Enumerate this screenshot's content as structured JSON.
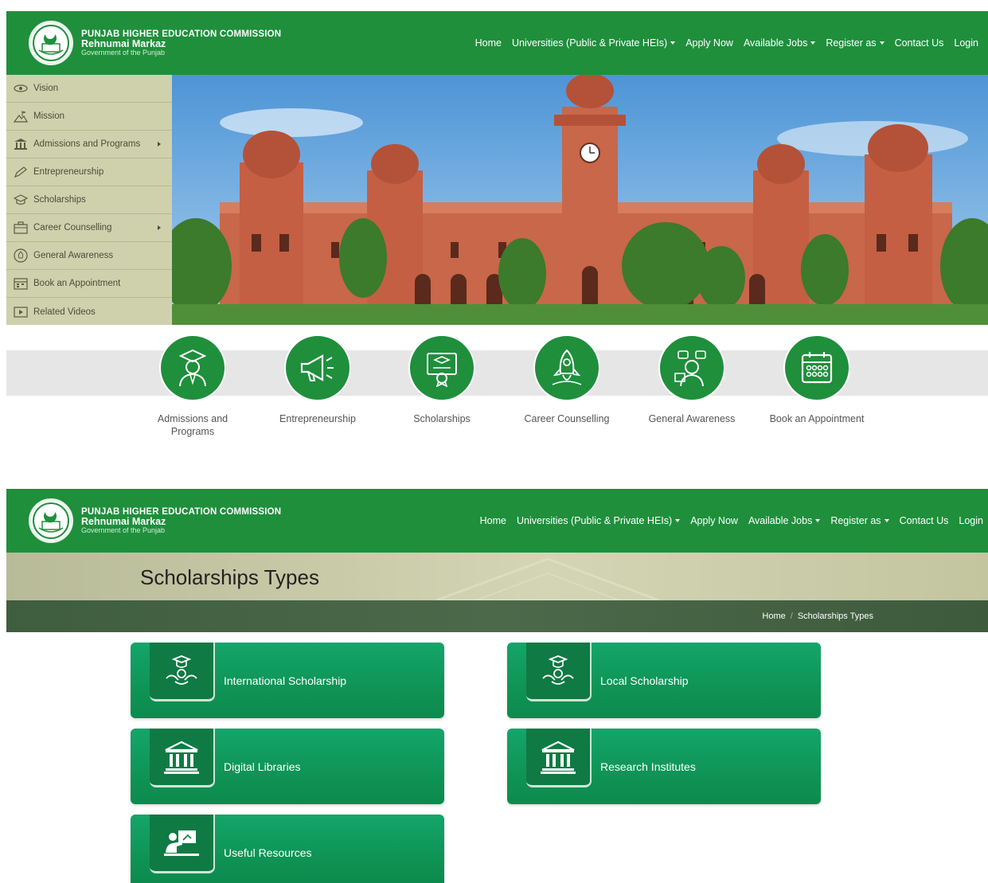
{
  "brand": {
    "line1": "PUNJAB HIGHER EDUCATION COMMISSION",
    "line2": "Rehnumai Markaz",
    "line3": "Government of the Punjab"
  },
  "nav": [
    {
      "label": "Home",
      "dropdown": false
    },
    {
      "label": "Universities (Public & Private HEIs)",
      "dropdown": true
    },
    {
      "label": "Apply Now",
      "dropdown": false
    },
    {
      "label": "Available Jobs",
      "dropdown": true
    },
    {
      "label": "Register as",
      "dropdown": true
    },
    {
      "label": "Contact Us",
      "dropdown": false
    },
    {
      "label": "Login",
      "dropdown": false
    }
  ],
  "sidebar": {
    "items": [
      {
        "label": "Vision",
        "icon": "eye-icon"
      },
      {
        "label": "Mission",
        "icon": "mountain-flag-icon"
      },
      {
        "label": "Admissions and Programs",
        "icon": "university-icon",
        "submenu": true
      },
      {
        "label": "Entrepreneurship",
        "icon": "pen-icon"
      },
      {
        "label": "Scholarships",
        "icon": "graduation-cap-icon"
      },
      {
        "label": "Career Counselling",
        "icon": "briefcase-icon",
        "submenu": true
      },
      {
        "label": "General Awareness",
        "icon": "lightbulb-icon"
      },
      {
        "label": "Book an Appointment",
        "icon": "calendar-icon"
      },
      {
        "label": "Related Videos",
        "icon": "video-icon"
      }
    ]
  },
  "features": [
    {
      "label": "Admissions and Programs",
      "icon": "graduate-icon"
    },
    {
      "label": "Entrepreneurship",
      "icon": "megaphone-icon"
    },
    {
      "label": "Scholarships",
      "icon": "certificate-icon"
    },
    {
      "label": "Career Counselling",
      "icon": "rocket-icon"
    },
    {
      "label": "General Awareness",
      "icon": "thinking-person-icon"
    },
    {
      "label": "Book an Appointment",
      "icon": "calendar-icon"
    }
  ],
  "page": {
    "title": "Scholarships Types",
    "breadcrumb": {
      "home": "Home",
      "current": "Scholarships Types"
    }
  },
  "cards": [
    {
      "label": "International Scholarship",
      "icon": "scholarship-icon"
    },
    {
      "label": "Local Scholarship",
      "icon": "scholarship-icon"
    },
    {
      "label": "Digital Libraries",
      "icon": "library-icon"
    },
    {
      "label": "Research Institutes",
      "icon": "library-icon"
    },
    {
      "label": "Useful Resources",
      "icon": "presentation-icon"
    }
  ],
  "colors": {
    "brand_green": "#1f8f3c",
    "card_green": "#12a062",
    "sidebar_bg": "#cfd1ad"
  }
}
